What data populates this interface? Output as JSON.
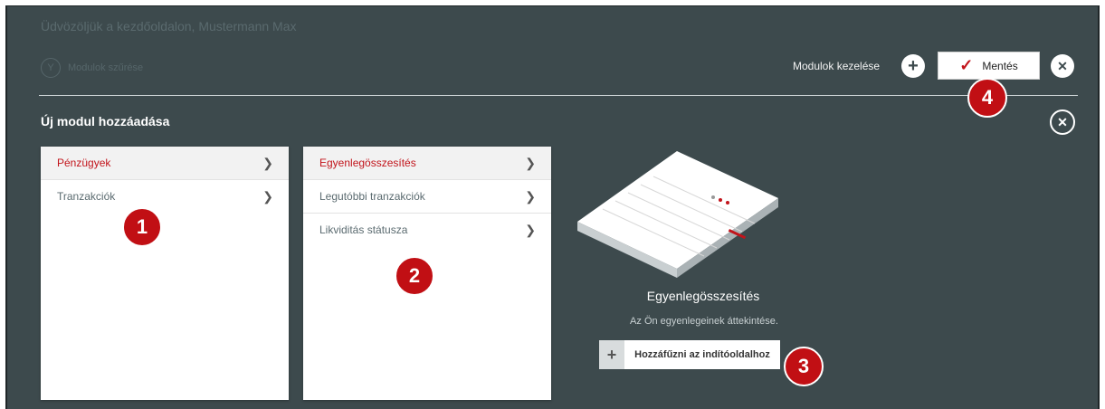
{
  "header": {
    "welcome": "Üdvözöljük a kezdőoldalon, Mustermann Max",
    "filter_label": "Modulok szűrése",
    "manage_label": "Modulok kezelése",
    "save_label": "Mentés"
  },
  "add_module": {
    "title": "Új modul hozzáadása"
  },
  "left_menu": [
    {
      "label": "Pénzügyek"
    },
    {
      "label": "Tranzakciók"
    }
  ],
  "right_menu": [
    {
      "label": "Egyenlegösszesítés"
    },
    {
      "label": "Legutóbbi tranzakciók"
    },
    {
      "label": "Likviditás státusza"
    }
  ],
  "preview": {
    "title": "Egyenlegösszesítés",
    "description": "Az Ön egyenlegeinek áttekintése.",
    "add_button": "Hozzáfűzni az indítóoldalhoz"
  },
  "badges": [
    "1",
    "2",
    "3",
    "4"
  ],
  "colors": {
    "background": "#3d4a4d",
    "accent": "#c2141b",
    "badge": "#c10f14"
  }
}
